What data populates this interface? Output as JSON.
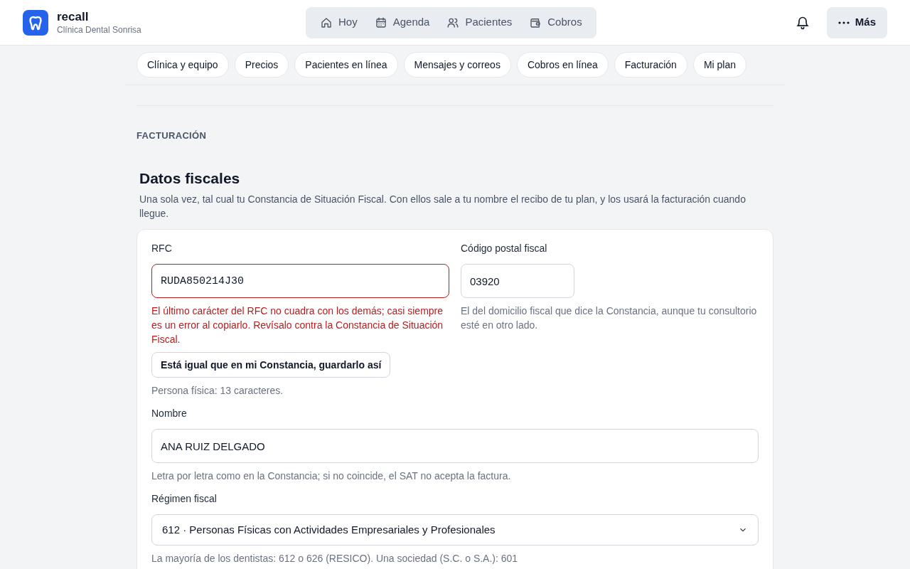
{
  "brand": {
    "name": "recall",
    "subtitle": "Clínica Dental Sonrisa"
  },
  "nav": [
    {
      "label": "Hoy",
      "kind": "home",
      "selected": false
    },
    {
      "label": "Agenda",
      "kind": "calendar",
      "selected": false
    },
    {
      "label": "Pacientes",
      "kind": "people",
      "selected": false
    },
    {
      "label": "Cobros",
      "kind": "wallet",
      "selected": false
    }
  ],
  "more_button": "Más",
  "settings_tabs": [
    {
      "label": "Clínica y equipo",
      "selected": false
    },
    {
      "label": "Precios",
      "selected": false
    },
    {
      "label": "Pacientes en línea",
      "selected": false
    },
    {
      "label": "Mensajes y correos",
      "selected": false
    },
    {
      "label": "Cobros en línea",
      "selected": false
    },
    {
      "label": "Facturación",
      "selected": false
    },
    {
      "label": "Mi plan",
      "selected": false
    }
  ],
  "section_label": "FACTURACIÓN",
  "section": {
    "title": "Datos fiscales",
    "description": "Una sola vez, tal cual tu Constancia de Situación Fiscal. Con ellos sale a tu nombre el recibo de tu plan, y los usará la facturación cuando llegue."
  },
  "form": {
    "rfc": {
      "label": "RFC",
      "value": "RUDA850214J30",
      "invalid": true,
      "error": "El último carácter del RFC no cuadra con los demás; casi siempre es un error al copiarlo. Revísalo contra la Constancia de Situación Fiscal.",
      "confirm_button": "Está igual que en mi Constancia, guardarlo así",
      "hint": "Persona física: 13 caracteres."
    },
    "postal_code": {
      "label": "Código postal fiscal",
      "value": "03920",
      "hint": "El del domicilio fiscal que dice la Constancia, aunque tu consultorio esté en otro lado."
    },
    "name": {
      "label": "Nombre",
      "value": "ANA RUIZ DELGADO",
      "hint": "Letra por letra como en la Constancia; si no coincide, el SAT no acepta la factura."
    },
    "regime": {
      "label": "Régimen fiscal",
      "value": "612 · Personas Físicas con Actividades Empresariales y Profesionales",
      "hint": "La mayoría de los dentistas: 612 o 626 (RESICO). Una sociedad (S.C. o S.A.): 601"
    }
  }
}
